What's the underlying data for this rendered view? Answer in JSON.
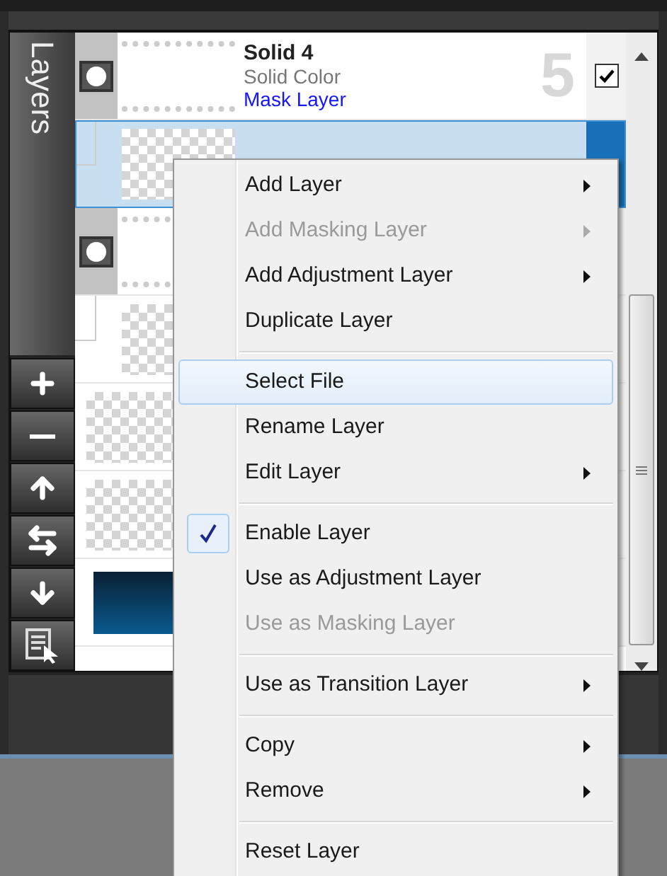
{
  "panel": {
    "tab": "Layers"
  },
  "layers": [
    {
      "kind": "group",
      "name": "Solid 4",
      "type_label": "Solid Color",
      "mask_label": "Mask Layer",
      "number": "5",
      "checked": true,
      "selected": false
    },
    {
      "kind": "child",
      "selected": true
    },
    {
      "kind": "group",
      "selected": false
    },
    {
      "kind": "child",
      "selected": false
    },
    {
      "kind": "plain",
      "selected": false
    },
    {
      "kind": "plain",
      "selected": false
    },
    {
      "kind": "gradient",
      "selected": false
    }
  ],
  "menu": {
    "groups": [
      [
        {
          "label": "Add Layer",
          "disabled": false,
          "submenu": true,
          "checked": false,
          "selected": false
        },
        {
          "label": "Add Masking Layer",
          "disabled": true,
          "submenu": true,
          "checked": false,
          "selected": false
        },
        {
          "label": "Add Adjustment Layer",
          "disabled": false,
          "submenu": true,
          "checked": false,
          "selected": false
        },
        {
          "label": "Duplicate Layer",
          "disabled": false,
          "submenu": false,
          "checked": false,
          "selected": false
        }
      ],
      [
        {
          "label": "Select File",
          "disabled": false,
          "submenu": false,
          "checked": false,
          "selected": true
        },
        {
          "label": "Rename Layer",
          "disabled": false,
          "submenu": false,
          "checked": false,
          "selected": false
        },
        {
          "label": "Edit Layer",
          "disabled": false,
          "submenu": true,
          "checked": false,
          "selected": false
        }
      ],
      [
        {
          "label": "Enable Layer",
          "disabled": false,
          "submenu": false,
          "checked": true,
          "selected": false
        },
        {
          "label": "Use as Adjustment Layer",
          "disabled": false,
          "submenu": false,
          "checked": false,
          "selected": false
        },
        {
          "label": "Use as Masking Layer",
          "disabled": true,
          "submenu": false,
          "checked": false,
          "selected": false
        }
      ],
      [
        {
          "label": "Use as Transition Layer",
          "disabled": false,
          "submenu": true,
          "checked": false,
          "selected": false
        }
      ],
      [
        {
          "label": "Copy",
          "disabled": false,
          "submenu": true,
          "checked": false,
          "selected": false
        },
        {
          "label": "Remove",
          "disabled": false,
          "submenu": true,
          "checked": false,
          "selected": false
        }
      ],
      [
        {
          "label": "Reset Layer",
          "disabled": false,
          "submenu": false,
          "checked": false,
          "selected": false
        }
      ]
    ]
  }
}
